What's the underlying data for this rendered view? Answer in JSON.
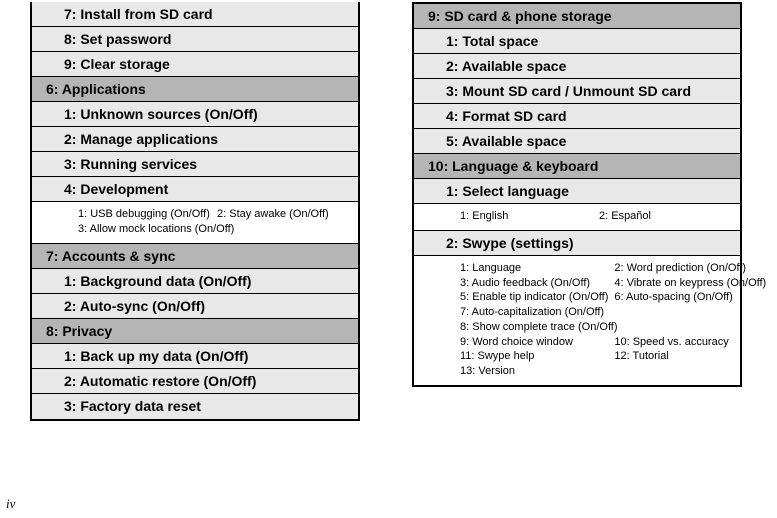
{
  "page_number": "iv",
  "left": {
    "items_above": [
      "7: Install from SD card",
      "8: Set password",
      "9: Clear storage"
    ],
    "sec6": {
      "heading": "6: Applications",
      "items": [
        "1: Unknown sources (On/Off)",
        "2: Manage applications",
        "3: Running services",
        "4: Development"
      ],
      "dev": {
        "c1": "1: USB debugging (On/Off)",
        "c2": "2: Stay awake (On/Off)",
        "c3": "3: Allow mock locations (On/Off)"
      }
    },
    "sec7": {
      "heading": "7: Accounts & sync",
      "items": [
        "1: Background data (On/Off)",
        "2: Auto-sync (On/Off)"
      ]
    },
    "sec8": {
      "heading": "8: Privacy",
      "items": [
        "1: Back up my data (On/Off)",
        "2: Automatic restore (On/Off)",
        "3: Factory data reset"
      ]
    }
  },
  "right": {
    "sec9": {
      "heading": "9: SD card & phone storage",
      "items": [
        "1: Total space",
        "2: Available space",
        "3: Mount SD card / Unmount SD card",
        "4: Format SD card",
        "5: Available space"
      ]
    },
    "sec10": {
      "heading": "10: Language & keyboard",
      "items": [
        "1: Select language",
        "2: Swype (settings)"
      ],
      "lang": {
        "c1": "1: English",
        "c2": "2: Español"
      },
      "swype": {
        "c1": "1: Language",
        "c2": "2: Word prediction (On/Off)",
        "c3": "3: Audio feedback (On/Off)",
        "c4": "4: Vibrate on keypress (On/Off)",
        "c5": "5: Enable tip indicator (On/Off)",
        "c6": "6: Auto-spacing (On/Off)",
        "c7": "7: Auto-capitalization (On/Off)",
        "c8": "8: Show complete trace (On/Off)",
        "c9": "9: Word choice window",
        "c10": "10: Speed vs. accuracy",
        "c11": "11: Swype help",
        "c12": "12: Tutorial",
        "c13": "13: Version"
      }
    }
  }
}
